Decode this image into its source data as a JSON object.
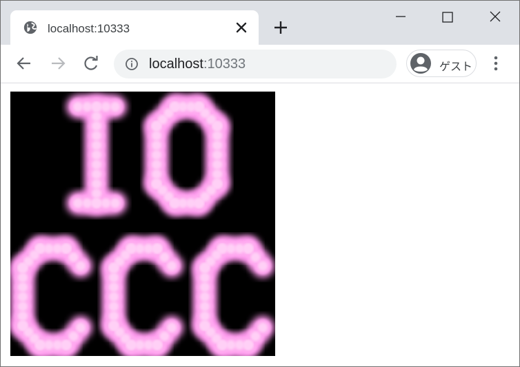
{
  "tab": {
    "title": "localhost:10333",
    "icon": "globe-icon"
  },
  "window_controls": {
    "minimize": "minimize-icon",
    "maximize": "maximize-icon",
    "close": "close-icon"
  },
  "toolbar": {
    "url_host": "localhost",
    "url_port": ":10333",
    "profile_label": "ゲスト"
  },
  "canvas": {
    "text_rows": [
      "IO",
      "CCC"
    ],
    "background": "#000000",
    "glow_color": "#ff99ee",
    "core_color": "#ffd0f6"
  },
  "colors": {
    "tabstrip": "#dee1e6",
    "omnibox": "#f1f3f4",
    "icon": "#5f6368"
  }
}
